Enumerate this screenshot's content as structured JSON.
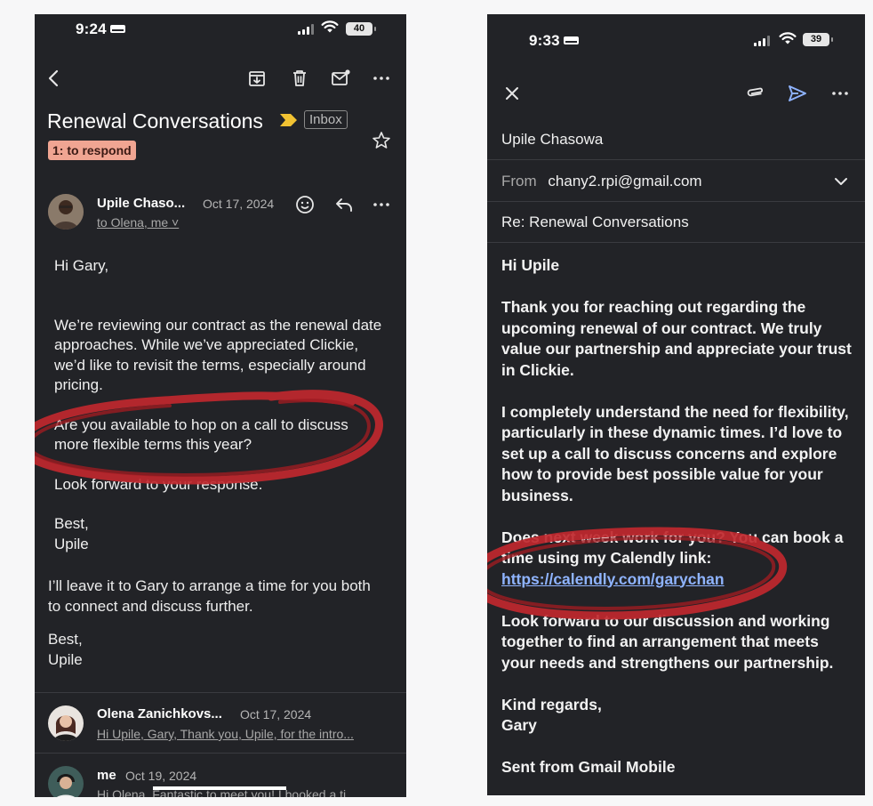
{
  "left_phone": {
    "status": {
      "time": "9:24",
      "battery": "40"
    },
    "toolbar": {
      "back_icon": "chevron-left-icon",
      "archive_icon": "archive-icon",
      "delete_icon": "trash-icon",
      "unread_icon": "mark-unread-icon",
      "more_icon": "more-icon"
    },
    "thread": {
      "subject": "Renewal Conversations",
      "label": "Inbox",
      "tag": "1: to respond"
    },
    "message": {
      "sender": "Upile Chaso...",
      "date": "Oct 17, 2024",
      "recipients": "to Olena, me",
      "body": [
        "Hi Gary,",
        "We’re reviewing our contract as the renewal date approaches. While we’ve appreciated Clickie, we’d like to revisit the terms, especially around pricing.",
        "Are you available to hop on a call to discuss more flexible terms this year?",
        "Look forward to your response.",
        "Best,",
        "Upile"
      ],
      "quote": "I’ll leave it to Gary to arrange a time for you both to connect and discuss further.",
      "signoff": "Best,",
      "signname": "Upile"
    },
    "replies": [
      {
        "sender": "Olena Zanichkovs...",
        "date": "Oct 17, 2024",
        "snippet": "Hi Upile, Gary, Thank you, Upile, for the intro..."
      },
      {
        "sender": "me",
        "date": "Oct 19, 2024",
        "snippet": "Hi Olena, Fantastic to meet you! I booked a ti..."
      }
    ]
  },
  "right_phone": {
    "status": {
      "time": "9:33",
      "battery": "39"
    },
    "toolbar": {
      "close_icon": "close-icon",
      "attach_icon": "paperclip-icon",
      "send_icon": "send-icon",
      "more_icon": "more-icon"
    },
    "compose": {
      "to": "Upile Chasowa",
      "from_label": "From",
      "from": "chany2.rpi@gmail.com",
      "subject": "Re: Renewal Conversations",
      "greeting": "Hi Upile",
      "p1": "Thank you for reaching out regarding the upcoming renewal of our contract. We truly value our partnership and appreciate your trust in Clickie.",
      "p2": "I completely understand the need for flexibility, particularly in these dynamic times. I’d love to set up a call to discuss concerns and explore how to provide best possible value for your business.",
      "p3": "Does next week work for you? You can book a time using my Calendly link:",
      "link": "https://calendly.com/garychan",
      "p4": "Look forward to our discussion and working together to find an arrangement that meets your needs and strengthens our partnership.",
      "closing": "Kind regards,",
      "name": "Gary",
      "footer": "Sent from Gmail Mobile"
    }
  },
  "colors": {
    "background": "#222327",
    "accent_link": "#8fb4ff",
    "tag": "#f0a592",
    "annotation": "#c0282e"
  }
}
